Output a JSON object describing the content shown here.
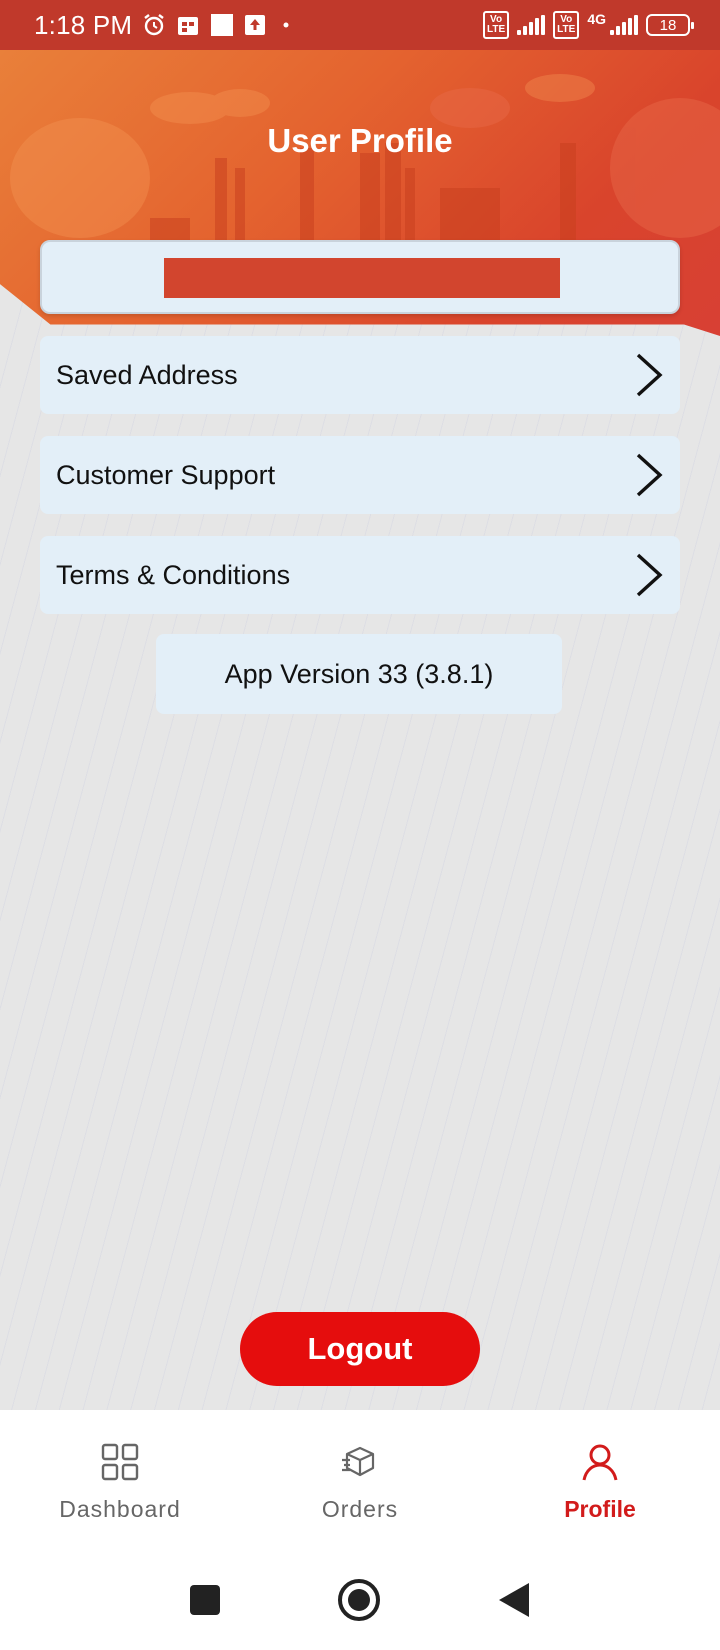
{
  "status_bar": {
    "time": "1:18 PM",
    "network_label": "4G",
    "volte_label": "Vo\nLTE",
    "battery": "18",
    "icons": [
      "alarm-icon",
      "calendar-icon",
      "notification-square-icon",
      "upload-icon",
      "dot-icon",
      "volte-icon",
      "signal-icon",
      "battery-icon"
    ]
  },
  "header": {
    "title": "User Profile"
  },
  "menu": {
    "items": [
      {
        "label": "Saved Address",
        "icon": "chevron-right-icon"
      },
      {
        "label": "Customer Support",
        "icon": "chevron-right-icon"
      },
      {
        "label": "Terms & Conditions",
        "icon": "chevron-right-icon"
      }
    ]
  },
  "version": {
    "text": "App Version 33 (3.8.1)"
  },
  "logout": {
    "label": "Logout"
  },
  "bottom_nav": {
    "items": [
      {
        "label": "Dashboard",
        "icon": "grid-icon",
        "active": false
      },
      {
        "label": "Orders",
        "icon": "box-icon",
        "active": false
      },
      {
        "label": "Profile",
        "icon": "person-icon",
        "active": true
      }
    ]
  },
  "colors": {
    "accent": "#e50d0d",
    "header_gradient_start": "#e9803a",
    "header_gradient_end": "#d84034",
    "card_bg": "#e3eff8",
    "active_nav": "#d21b1b"
  },
  "system_nav": [
    "recents-square-icon",
    "home-circle-icon",
    "back-triangle-icon"
  ]
}
